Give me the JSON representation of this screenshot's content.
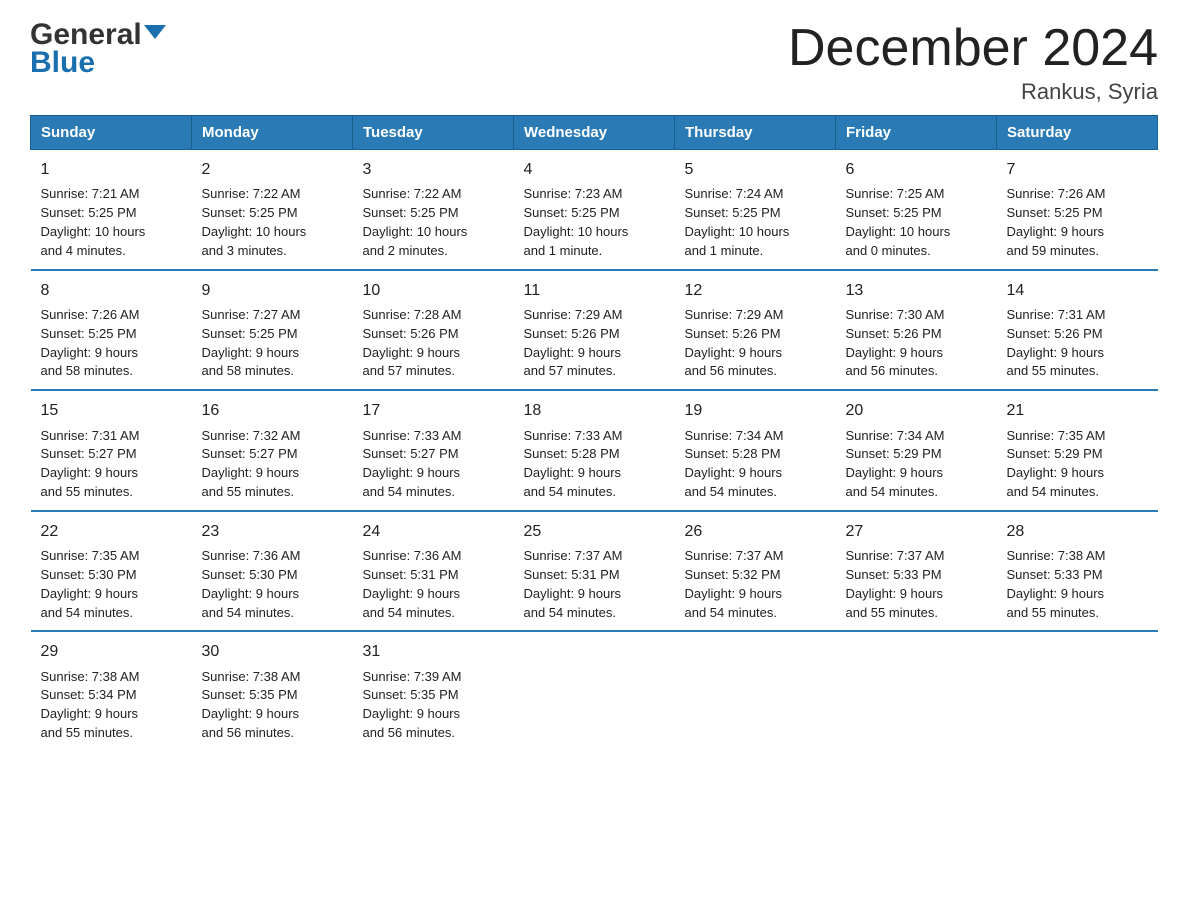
{
  "header": {
    "logo_general": "General",
    "logo_blue": "Blue",
    "page_title": "December 2024",
    "subtitle": "Rankus, Syria"
  },
  "columns": [
    "Sunday",
    "Monday",
    "Tuesday",
    "Wednesday",
    "Thursday",
    "Friday",
    "Saturday"
  ],
  "weeks": [
    [
      {
        "day": "1",
        "sunrise": "7:21 AM",
        "sunset": "5:25 PM",
        "daylight": "10 hours and 4 minutes."
      },
      {
        "day": "2",
        "sunrise": "7:22 AM",
        "sunset": "5:25 PM",
        "daylight": "10 hours and 3 minutes."
      },
      {
        "day": "3",
        "sunrise": "7:22 AM",
        "sunset": "5:25 PM",
        "daylight": "10 hours and 2 minutes."
      },
      {
        "day": "4",
        "sunrise": "7:23 AM",
        "sunset": "5:25 PM",
        "daylight": "10 hours and 1 minute."
      },
      {
        "day": "5",
        "sunrise": "7:24 AM",
        "sunset": "5:25 PM",
        "daylight": "10 hours and 1 minute."
      },
      {
        "day": "6",
        "sunrise": "7:25 AM",
        "sunset": "5:25 PM",
        "daylight": "10 hours and 0 minutes."
      },
      {
        "day": "7",
        "sunrise": "7:26 AM",
        "sunset": "5:25 PM",
        "daylight": "9 hours and 59 minutes."
      }
    ],
    [
      {
        "day": "8",
        "sunrise": "7:26 AM",
        "sunset": "5:25 PM",
        "daylight": "9 hours and 58 minutes."
      },
      {
        "day": "9",
        "sunrise": "7:27 AM",
        "sunset": "5:25 PM",
        "daylight": "9 hours and 58 minutes."
      },
      {
        "day": "10",
        "sunrise": "7:28 AM",
        "sunset": "5:26 PM",
        "daylight": "9 hours and 57 minutes."
      },
      {
        "day": "11",
        "sunrise": "7:29 AM",
        "sunset": "5:26 PM",
        "daylight": "9 hours and 57 minutes."
      },
      {
        "day": "12",
        "sunrise": "7:29 AM",
        "sunset": "5:26 PM",
        "daylight": "9 hours and 56 minutes."
      },
      {
        "day": "13",
        "sunrise": "7:30 AM",
        "sunset": "5:26 PM",
        "daylight": "9 hours and 56 minutes."
      },
      {
        "day": "14",
        "sunrise": "7:31 AM",
        "sunset": "5:26 PM",
        "daylight": "9 hours and 55 minutes."
      }
    ],
    [
      {
        "day": "15",
        "sunrise": "7:31 AM",
        "sunset": "5:27 PM",
        "daylight": "9 hours and 55 minutes."
      },
      {
        "day": "16",
        "sunrise": "7:32 AM",
        "sunset": "5:27 PM",
        "daylight": "9 hours and 55 minutes."
      },
      {
        "day": "17",
        "sunrise": "7:33 AM",
        "sunset": "5:27 PM",
        "daylight": "9 hours and 54 minutes."
      },
      {
        "day": "18",
        "sunrise": "7:33 AM",
        "sunset": "5:28 PM",
        "daylight": "9 hours and 54 minutes."
      },
      {
        "day": "19",
        "sunrise": "7:34 AM",
        "sunset": "5:28 PM",
        "daylight": "9 hours and 54 minutes."
      },
      {
        "day": "20",
        "sunrise": "7:34 AM",
        "sunset": "5:29 PM",
        "daylight": "9 hours and 54 minutes."
      },
      {
        "day": "21",
        "sunrise": "7:35 AM",
        "sunset": "5:29 PM",
        "daylight": "9 hours and 54 minutes."
      }
    ],
    [
      {
        "day": "22",
        "sunrise": "7:35 AM",
        "sunset": "5:30 PM",
        "daylight": "9 hours and 54 minutes."
      },
      {
        "day": "23",
        "sunrise": "7:36 AM",
        "sunset": "5:30 PM",
        "daylight": "9 hours and 54 minutes."
      },
      {
        "day": "24",
        "sunrise": "7:36 AM",
        "sunset": "5:31 PM",
        "daylight": "9 hours and 54 minutes."
      },
      {
        "day": "25",
        "sunrise": "7:37 AM",
        "sunset": "5:31 PM",
        "daylight": "9 hours and 54 minutes."
      },
      {
        "day": "26",
        "sunrise": "7:37 AM",
        "sunset": "5:32 PM",
        "daylight": "9 hours and 54 minutes."
      },
      {
        "day": "27",
        "sunrise": "7:37 AM",
        "sunset": "5:33 PM",
        "daylight": "9 hours and 55 minutes."
      },
      {
        "day": "28",
        "sunrise": "7:38 AM",
        "sunset": "5:33 PM",
        "daylight": "9 hours and 55 minutes."
      }
    ],
    [
      {
        "day": "29",
        "sunrise": "7:38 AM",
        "sunset": "5:34 PM",
        "daylight": "9 hours and 55 minutes."
      },
      {
        "day": "30",
        "sunrise": "7:38 AM",
        "sunset": "5:35 PM",
        "daylight": "9 hours and 56 minutes."
      },
      {
        "day": "31",
        "sunrise": "7:39 AM",
        "sunset": "5:35 PM",
        "daylight": "9 hours and 56 minutes."
      },
      null,
      null,
      null,
      null
    ]
  ]
}
